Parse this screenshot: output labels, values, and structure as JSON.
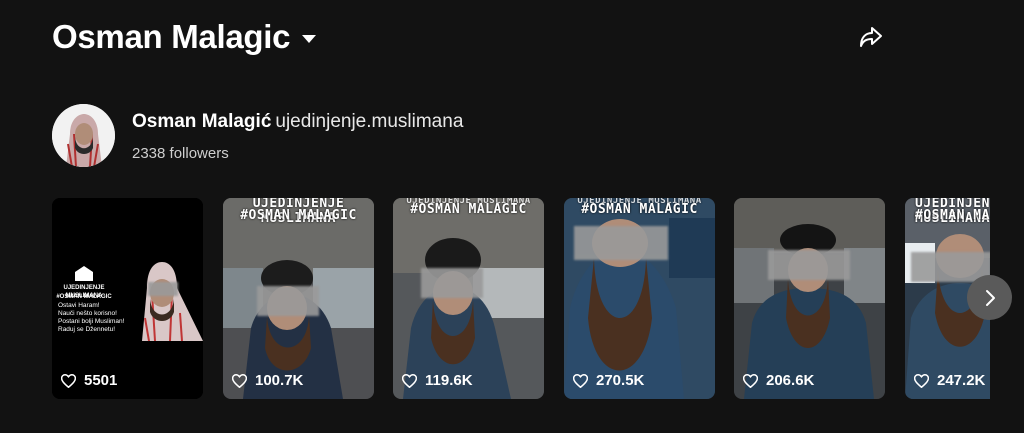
{
  "header": {
    "title": "Osman Malagic"
  },
  "profile": {
    "name": "Osman Malagić",
    "handle": "ujedinjenje.muslimana",
    "followers": "2338 followers"
  },
  "card1": {
    "brand_line1": "UJEDINJENJE MUSLIMANA",
    "brand_line2": "#OSMAN MALAGIC",
    "text1": "Ostavi Haram!",
    "text2": "Nauči nešto korisno!",
    "text3": "Postani bolji Musliman!",
    "text4": "Raduj se Džennetu!"
  },
  "captions": {
    "top": "UJEDINJENJE MUSLIMANA",
    "tag": "#OSMAN MALAGIC"
  },
  "videos": [
    {
      "likes": "5501"
    },
    {
      "likes": "100.7K"
    },
    {
      "likes": "119.6K"
    },
    {
      "likes": "270.5K"
    },
    {
      "likes": "206.6K"
    },
    {
      "likes": "247.2K"
    }
  ]
}
